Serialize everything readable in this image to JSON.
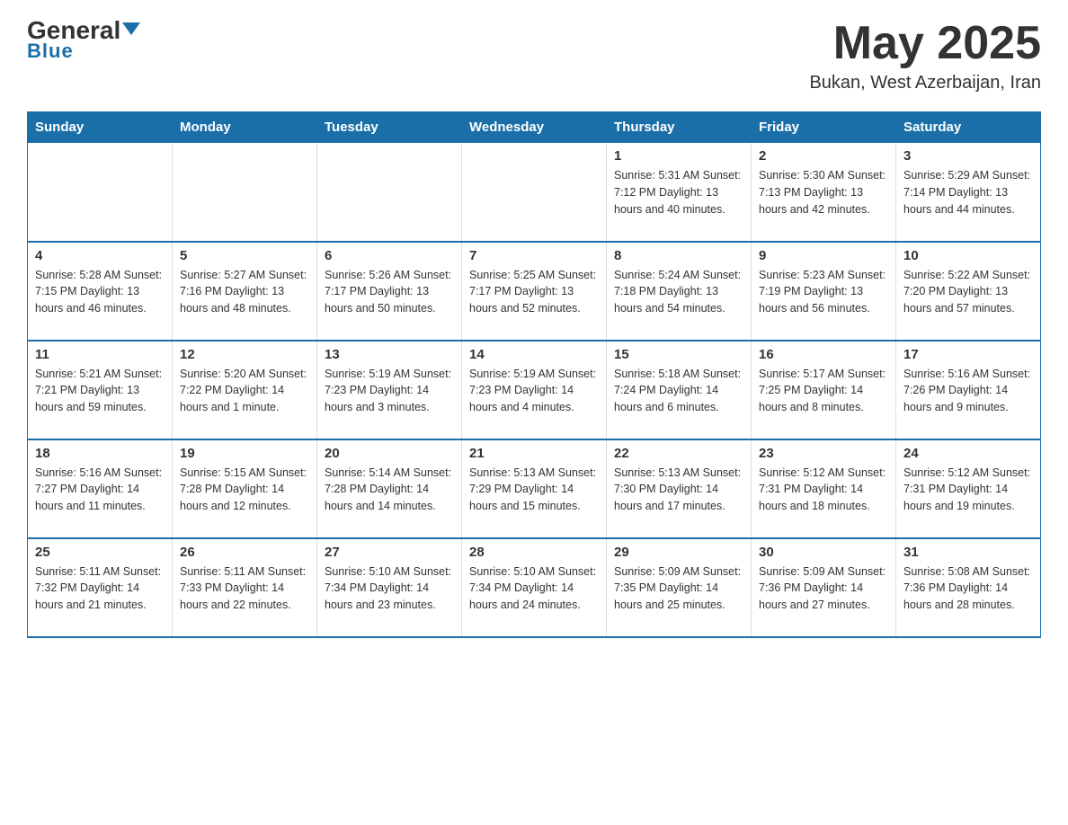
{
  "header": {
    "logo_general": "General",
    "logo_blue": "Blue",
    "main_title": "May 2025",
    "subtitle": "Bukan, West Azerbaijan, Iran"
  },
  "columns": [
    "Sunday",
    "Monday",
    "Tuesday",
    "Wednesday",
    "Thursday",
    "Friday",
    "Saturday"
  ],
  "weeks": [
    [
      {
        "day": "",
        "info": ""
      },
      {
        "day": "",
        "info": ""
      },
      {
        "day": "",
        "info": ""
      },
      {
        "day": "",
        "info": ""
      },
      {
        "day": "1",
        "info": "Sunrise: 5:31 AM\nSunset: 7:12 PM\nDaylight: 13 hours\nand 40 minutes."
      },
      {
        "day": "2",
        "info": "Sunrise: 5:30 AM\nSunset: 7:13 PM\nDaylight: 13 hours\nand 42 minutes."
      },
      {
        "day": "3",
        "info": "Sunrise: 5:29 AM\nSunset: 7:14 PM\nDaylight: 13 hours\nand 44 minutes."
      }
    ],
    [
      {
        "day": "4",
        "info": "Sunrise: 5:28 AM\nSunset: 7:15 PM\nDaylight: 13 hours\nand 46 minutes."
      },
      {
        "day": "5",
        "info": "Sunrise: 5:27 AM\nSunset: 7:16 PM\nDaylight: 13 hours\nand 48 minutes."
      },
      {
        "day": "6",
        "info": "Sunrise: 5:26 AM\nSunset: 7:17 PM\nDaylight: 13 hours\nand 50 minutes."
      },
      {
        "day": "7",
        "info": "Sunrise: 5:25 AM\nSunset: 7:17 PM\nDaylight: 13 hours\nand 52 minutes."
      },
      {
        "day": "8",
        "info": "Sunrise: 5:24 AM\nSunset: 7:18 PM\nDaylight: 13 hours\nand 54 minutes."
      },
      {
        "day": "9",
        "info": "Sunrise: 5:23 AM\nSunset: 7:19 PM\nDaylight: 13 hours\nand 56 minutes."
      },
      {
        "day": "10",
        "info": "Sunrise: 5:22 AM\nSunset: 7:20 PM\nDaylight: 13 hours\nand 57 minutes."
      }
    ],
    [
      {
        "day": "11",
        "info": "Sunrise: 5:21 AM\nSunset: 7:21 PM\nDaylight: 13 hours\nand 59 minutes."
      },
      {
        "day": "12",
        "info": "Sunrise: 5:20 AM\nSunset: 7:22 PM\nDaylight: 14 hours\nand 1 minute."
      },
      {
        "day": "13",
        "info": "Sunrise: 5:19 AM\nSunset: 7:23 PM\nDaylight: 14 hours\nand 3 minutes."
      },
      {
        "day": "14",
        "info": "Sunrise: 5:19 AM\nSunset: 7:23 PM\nDaylight: 14 hours\nand 4 minutes."
      },
      {
        "day": "15",
        "info": "Sunrise: 5:18 AM\nSunset: 7:24 PM\nDaylight: 14 hours\nand 6 minutes."
      },
      {
        "day": "16",
        "info": "Sunrise: 5:17 AM\nSunset: 7:25 PM\nDaylight: 14 hours\nand 8 minutes."
      },
      {
        "day": "17",
        "info": "Sunrise: 5:16 AM\nSunset: 7:26 PM\nDaylight: 14 hours\nand 9 minutes."
      }
    ],
    [
      {
        "day": "18",
        "info": "Sunrise: 5:16 AM\nSunset: 7:27 PM\nDaylight: 14 hours\nand 11 minutes."
      },
      {
        "day": "19",
        "info": "Sunrise: 5:15 AM\nSunset: 7:28 PM\nDaylight: 14 hours\nand 12 minutes."
      },
      {
        "day": "20",
        "info": "Sunrise: 5:14 AM\nSunset: 7:28 PM\nDaylight: 14 hours\nand 14 minutes."
      },
      {
        "day": "21",
        "info": "Sunrise: 5:13 AM\nSunset: 7:29 PM\nDaylight: 14 hours\nand 15 minutes."
      },
      {
        "day": "22",
        "info": "Sunrise: 5:13 AM\nSunset: 7:30 PM\nDaylight: 14 hours\nand 17 minutes."
      },
      {
        "day": "23",
        "info": "Sunrise: 5:12 AM\nSunset: 7:31 PM\nDaylight: 14 hours\nand 18 minutes."
      },
      {
        "day": "24",
        "info": "Sunrise: 5:12 AM\nSunset: 7:31 PM\nDaylight: 14 hours\nand 19 minutes."
      }
    ],
    [
      {
        "day": "25",
        "info": "Sunrise: 5:11 AM\nSunset: 7:32 PM\nDaylight: 14 hours\nand 21 minutes."
      },
      {
        "day": "26",
        "info": "Sunrise: 5:11 AM\nSunset: 7:33 PM\nDaylight: 14 hours\nand 22 minutes."
      },
      {
        "day": "27",
        "info": "Sunrise: 5:10 AM\nSunset: 7:34 PM\nDaylight: 14 hours\nand 23 minutes."
      },
      {
        "day": "28",
        "info": "Sunrise: 5:10 AM\nSunset: 7:34 PM\nDaylight: 14 hours\nand 24 minutes."
      },
      {
        "day": "29",
        "info": "Sunrise: 5:09 AM\nSunset: 7:35 PM\nDaylight: 14 hours\nand 25 minutes."
      },
      {
        "day": "30",
        "info": "Sunrise: 5:09 AM\nSunset: 7:36 PM\nDaylight: 14 hours\nand 27 minutes."
      },
      {
        "day": "31",
        "info": "Sunrise: 5:08 AM\nSunset: 7:36 PM\nDaylight: 14 hours\nand 28 minutes."
      }
    ]
  ]
}
